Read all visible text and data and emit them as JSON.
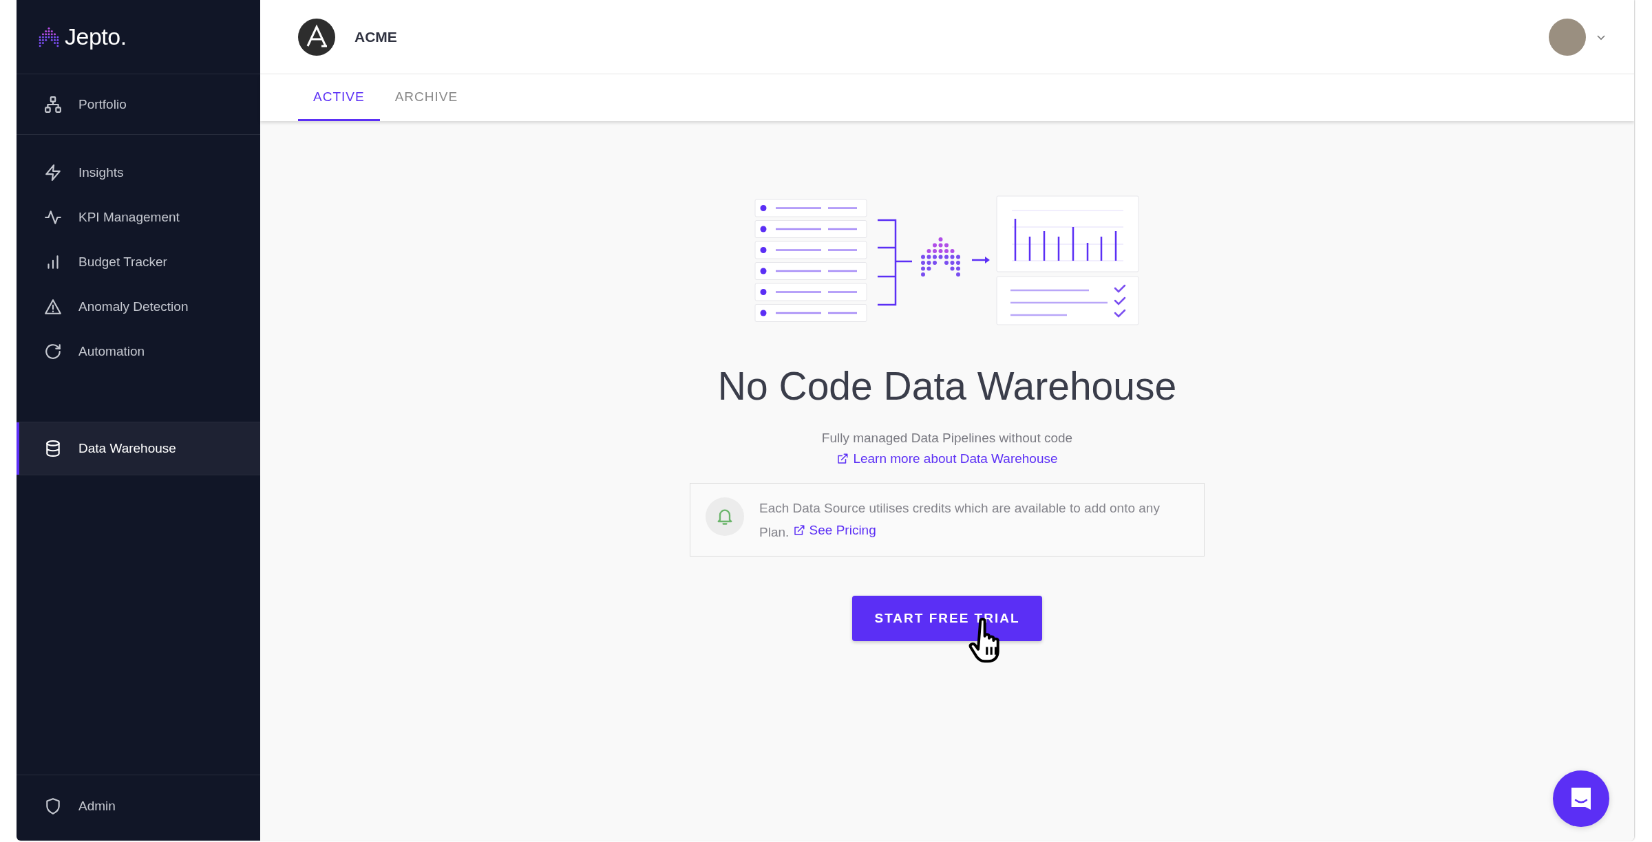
{
  "sidebar": {
    "logo": "Jepto.",
    "groups": [
      [
        {
          "label": "Portfolio",
          "selected": false
        }
      ],
      [
        {
          "label": "Insights",
          "selected": false
        },
        {
          "label": "KPI Management",
          "selected": false
        },
        {
          "label": "Budget Tracker",
          "selected": false
        },
        {
          "label": "Anomaly Detection",
          "selected": false
        },
        {
          "label": "Automation",
          "selected": false
        }
      ],
      [
        {
          "label": "Data Warehouse",
          "selected": true
        }
      ]
    ],
    "footer": [
      {
        "label": "Admin",
        "selected": false
      }
    ]
  },
  "header": {
    "org": "ACME"
  },
  "tabs": [
    {
      "label": "ACTIVE",
      "selected": true
    },
    {
      "label": "ARCHIVE",
      "selected": false
    }
  ],
  "empty_state": {
    "title": "No Code Data Warehouse",
    "subtitle": "Fully managed Data Pipelines without code",
    "link": "Learn more about Data Warehouse",
    "notice": {
      "text": "Each Data Source utilises credits which are available to add onto any Plan.",
      "link": "See Pricing"
    },
    "button": "START FREE TRIAL"
  }
}
